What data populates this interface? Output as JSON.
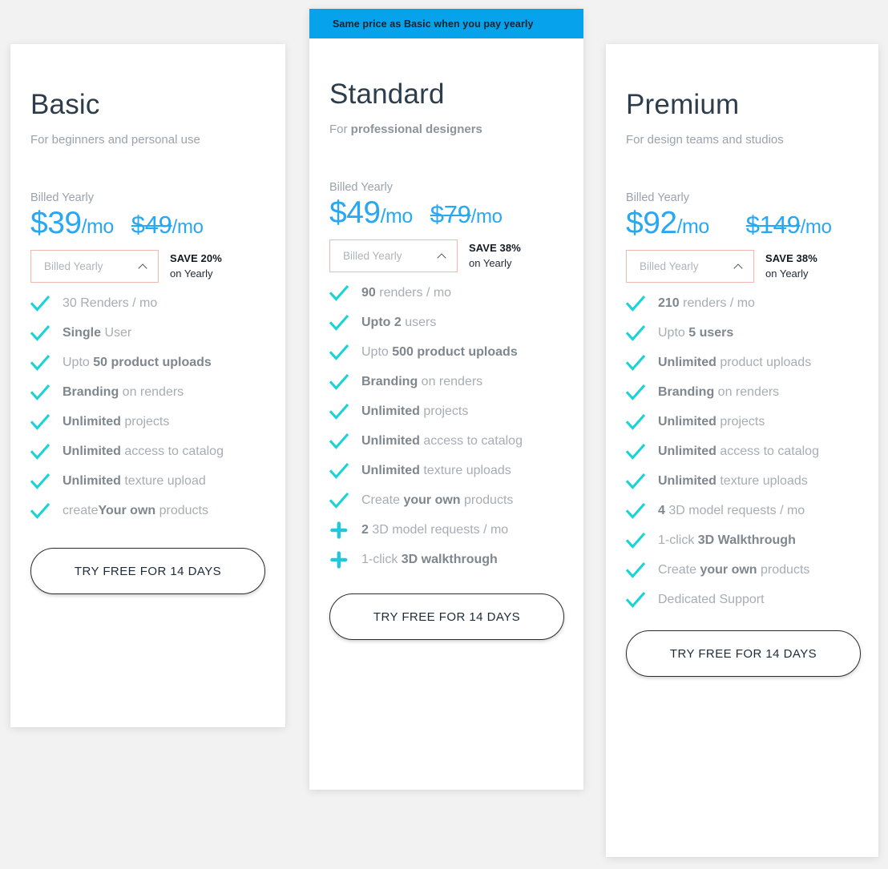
{
  "page": {
    "background_color": "#f2f2f2",
    "accent_blue": "#28a8f3",
    "ribbon_blue": "#06a3ec",
    "check_teal": "#19d4d4",
    "select_border": "#f0b9ad"
  },
  "plans": [
    {
      "id": "basic",
      "name": "Basic",
      "tagline_parts": [
        {
          "text": "For beginners and personal use",
          "bold": false
        }
      ],
      "billed_label": "Billed Yearly",
      "price_current_symbol": "$",
      "price_current_amount": "39",
      "price_current_unit": "/mo",
      "price_old_symbol": "$",
      "price_old_amount": "49",
      "price_old_unit": "/mo",
      "billing_select_value": "Billed Yearly",
      "save_headline": "SAVE 20%",
      "save_subline": "on Yearly",
      "features": [
        {
          "icon": "check",
          "parts": [
            {
              "text": "30 Renders / mo",
              "bold": false
            }
          ]
        },
        {
          "icon": "check",
          "parts": [
            {
              "text": "Single ",
              "bold": true
            },
            {
              "text": "User",
              "bold": false
            }
          ]
        },
        {
          "icon": "check",
          "parts": [
            {
              "text": "Upto ",
              "bold": false
            },
            {
              "text": "50 product uploads",
              "bold": true
            }
          ]
        },
        {
          "icon": "check",
          "parts": [
            {
              "text": "Branding ",
              "bold": true
            },
            {
              "text": "on renders",
              "bold": false
            }
          ]
        },
        {
          "icon": "check",
          "parts": [
            {
              "text": "Unlimited ",
              "bold": true
            },
            {
              "text": "projects",
              "bold": false
            }
          ]
        },
        {
          "icon": "check",
          "parts": [
            {
              "text": "Unlimited ",
              "bold": true
            },
            {
              "text": "access to catalog",
              "bold": false
            }
          ]
        },
        {
          "icon": "check",
          "parts": [
            {
              "text": "Unlimited ",
              "bold": true
            },
            {
              "text": "texture upload",
              "bold": false
            }
          ]
        },
        {
          "icon": "check",
          "parts": [
            {
              "text": "create",
              "bold": false
            },
            {
              "text": "Your own ",
              "bold": true
            },
            {
              "text": "products",
              "bold": false
            }
          ]
        }
      ],
      "cta_label": "TRY FREE FOR 14 DAYS"
    },
    {
      "id": "standard",
      "ribbon_text": "Same price as Basic when you pay yearly",
      "name": "Standard",
      "tagline_parts": [
        {
          "text": "For ",
          "bold": false
        },
        {
          "text": "professional designers",
          "bold": true
        }
      ],
      "billed_label": "Billed Yearly",
      "price_current_symbol": "$",
      "price_current_amount": "49",
      "price_current_unit": "/mo",
      "price_old_symbol": "$",
      "price_old_amount": "79",
      "price_old_unit": "/mo",
      "billing_select_value": "Billed Yearly",
      "save_headline": "SAVE 38%",
      "save_subline": "on Yearly",
      "features": [
        {
          "icon": "check",
          "parts": [
            {
              "text": "90 ",
              "bold": true
            },
            {
              "text": "renders / mo",
              "bold": false
            }
          ]
        },
        {
          "icon": "check",
          "parts": [
            {
              "text": "Upto 2 ",
              "bold": true
            },
            {
              "text": "users",
              "bold": false
            }
          ]
        },
        {
          "icon": "check",
          "parts": [
            {
              "text": "Upto ",
              "bold": false
            },
            {
              "text": "500 product uploads",
              "bold": true
            }
          ]
        },
        {
          "icon": "check",
          "parts": [
            {
              "text": "Branding ",
              "bold": true
            },
            {
              "text": "on renders",
              "bold": false
            }
          ]
        },
        {
          "icon": "check",
          "parts": [
            {
              "text": "Unlimited ",
              "bold": true
            },
            {
              "text": "projects",
              "bold": false
            }
          ]
        },
        {
          "icon": "check",
          "parts": [
            {
              "text": "Unlimited ",
              "bold": true
            },
            {
              "text": "access to catalog",
              "bold": false
            }
          ]
        },
        {
          "icon": "check",
          "parts": [
            {
              "text": "Unlimited ",
              "bold": true
            },
            {
              "text": "texture uploads",
              "bold": false
            }
          ]
        },
        {
          "icon": "check",
          "parts": [
            {
              "text": "Create ",
              "bold": false
            },
            {
              "text": "your own ",
              "bold": true
            },
            {
              "text": "products",
              "bold": false
            }
          ]
        },
        {
          "icon": "plus",
          "parts": [
            {
              "text": "2 ",
              "bold": true
            },
            {
              "text": "3D model requests / mo",
              "bold": false
            }
          ]
        },
        {
          "icon": "plus",
          "parts": [
            {
              "text": "1-click ",
              "bold": false
            },
            {
              "text": "3D walkthrough",
              "bold": true
            }
          ]
        }
      ],
      "cta_label": "TRY FREE FOR 14 DAYS"
    },
    {
      "id": "premium",
      "name": "Premium",
      "tagline_parts": [
        {
          "text": "For design teams and studios",
          "bold": false
        }
      ],
      "billed_label": "Billed Yearly",
      "price_current_symbol": "$",
      "price_current_amount": "92",
      "price_current_unit": "/mo",
      "price_old_symbol": "$",
      "price_old_amount": "149",
      "price_old_unit": "/mo",
      "billing_select_value": "Billed Yearly",
      "save_headline": "SAVE 38%",
      "save_subline": "on Yearly",
      "features": [
        {
          "icon": "check",
          "parts": [
            {
              "text": "210 ",
              "bold": true
            },
            {
              "text": "renders / mo",
              "bold": false
            }
          ]
        },
        {
          "icon": "check",
          "parts": [
            {
              "text": "Upto ",
              "bold": false
            },
            {
              "text": "5 users",
              "bold": true
            }
          ]
        },
        {
          "icon": "check",
          "parts": [
            {
              "text": "Unlimited ",
              "bold": true
            },
            {
              "text": "product uploads",
              "bold": false
            }
          ]
        },
        {
          "icon": "check",
          "parts": [
            {
              "text": "Branding ",
              "bold": true
            },
            {
              "text": "on renders",
              "bold": false
            }
          ]
        },
        {
          "icon": "check",
          "parts": [
            {
              "text": "Unlimited ",
              "bold": true
            },
            {
              "text": "projects",
              "bold": false
            }
          ]
        },
        {
          "icon": "check",
          "parts": [
            {
              "text": "Unlimited ",
              "bold": true
            },
            {
              "text": "access to catalog",
              "bold": false
            }
          ]
        },
        {
          "icon": "check",
          "parts": [
            {
              "text": "Unlimited ",
              "bold": true
            },
            {
              "text": "texture uploads",
              "bold": false
            }
          ]
        },
        {
          "icon": "check",
          "parts": [
            {
              "text": "4 ",
              "bold": true
            },
            {
              "text": "3D model requests / mo",
              "bold": false
            }
          ]
        },
        {
          "icon": "check",
          "parts": [
            {
              "text": "1-click ",
              "bold": false
            },
            {
              "text": "3D Walkthrough",
              "bold": true
            }
          ]
        },
        {
          "icon": "check",
          "parts": [
            {
              "text": "Create ",
              "bold": false
            },
            {
              "text": "your own ",
              "bold": true
            },
            {
              "text": "products",
              "bold": false
            }
          ]
        },
        {
          "icon": "check",
          "parts": [
            {
              "text": "Dedicated Support",
              "bold": false
            }
          ]
        }
      ],
      "cta_label": "TRY FREE FOR 14 DAYS"
    }
  ]
}
